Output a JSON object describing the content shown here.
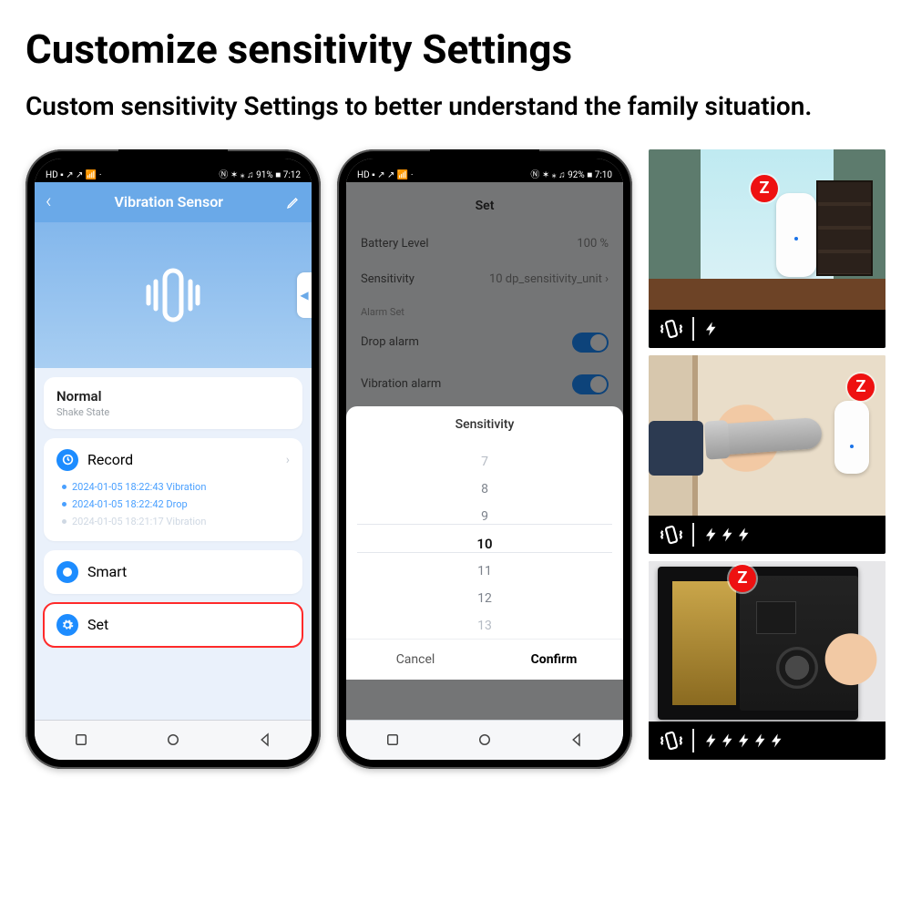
{
  "headline": "Customize sensitivity Settings",
  "subhead": "Custom sensitivity Settings to better understand the family situation.",
  "phone1": {
    "status": {
      "left": "HD ▪ ↗ ↗ 📶 ·",
      "right": "Ⓝ ✶ ⁎ ♫ 91% ■ 7:12"
    },
    "header": {
      "title": "Vibration Sensor"
    },
    "state": {
      "title": "Normal",
      "sub": "Shake State"
    },
    "record": {
      "label": "Record",
      "items": [
        "2024-01-05 18:22:43 Vibration",
        "2024-01-05 18:22:42 Drop",
        "2024-01-05 18:21:17 Vibration"
      ]
    },
    "smart": {
      "label": "Smart"
    },
    "set": {
      "label": "Set"
    }
  },
  "phone2": {
    "status": {
      "left": "HD ▪ ↗ ↗ 📶 ·",
      "right": "Ⓝ ✶ ⁎ ♫ 92% ■ 7:10"
    },
    "title": "Set",
    "rows": {
      "battery_label": "Battery Level",
      "battery_value": "100 %",
      "sensitivity_label": "Sensitivity",
      "sensitivity_value": "10 dp_sensitivity_unit"
    },
    "alarm_section": "Alarm Set",
    "drop_label": "Drop alarm",
    "vibration_label": "Vibration alarm",
    "sheet": {
      "title": "Sensitivity",
      "options": [
        "7",
        "8",
        "9",
        "10",
        "11",
        "12",
        "13"
      ],
      "cancel": "Cancel",
      "confirm": "Confirm"
    }
  },
  "tiles": {
    "bolt_counts": [
      1,
      3,
      5
    ]
  }
}
